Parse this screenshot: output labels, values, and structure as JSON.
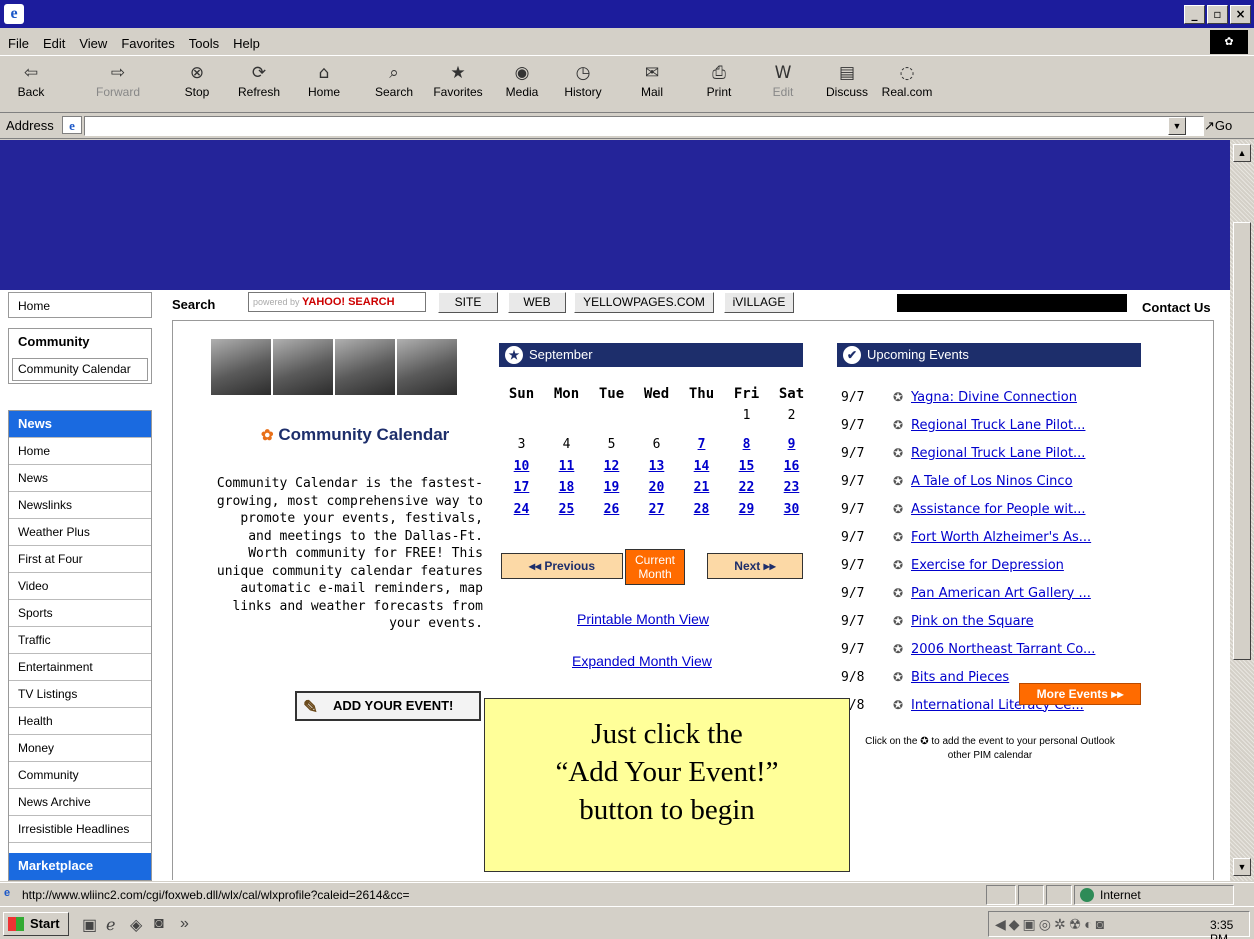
{
  "browser": {
    "menu": [
      "File",
      "Edit",
      "View",
      "Favorites",
      "Tools",
      "Help"
    ],
    "toolbar": [
      {
        "label": "Back",
        "icon": "back-arrow-icon"
      },
      {
        "label": "Forward",
        "icon": "forward-arrow-icon"
      },
      {
        "label": "Stop",
        "icon": "stop-icon"
      },
      {
        "label": "Refresh",
        "icon": "refresh-icon"
      },
      {
        "label": "Home",
        "icon": "home-icon"
      },
      {
        "label": "Search",
        "icon": "search-icon"
      },
      {
        "label": "Favorites",
        "icon": "favorites-icon"
      },
      {
        "label": "Media",
        "icon": "media-icon"
      },
      {
        "label": "History",
        "icon": "history-icon"
      },
      {
        "label": "Mail",
        "icon": "mail-icon"
      },
      {
        "label": "Print",
        "icon": "print-icon"
      },
      {
        "label": "Edit",
        "icon": "edit-icon"
      },
      {
        "label": "Discuss",
        "icon": "discuss-icon"
      },
      {
        "label": "Real.com",
        "icon": "realcom-icon"
      }
    ],
    "address_label": "Address",
    "address_value": "",
    "go_label": "Go",
    "status_url": "http://www.wliinc2.com/cgi/foxweb.dll/wlx/cal/wlxprofile?caleid=2614&cc=",
    "status_zone": "Internet"
  },
  "sidebar": {
    "home": "Home",
    "community_heading": "Community",
    "community_calendar": "Community Calendar",
    "news_heading": "News",
    "news_items": [
      "Home",
      "News",
      "Newslinks",
      "Weather Plus",
      "First at Four",
      "Video",
      "Sports",
      "Traffic",
      "Entertainment",
      "TV Listings",
      "Health",
      "Money",
      "Community",
      "News Archive",
      "Irresistible Headlines"
    ],
    "marketplace_heading": "Marketplace"
  },
  "search": {
    "label": "Search",
    "powered_by": "powered by",
    "engine": "YAHOO! SEARCH",
    "buttons": [
      "SITE",
      "WEB",
      "YELLOWPAGES.COM",
      "iVILLAGE"
    ],
    "contact": "Contact Us"
  },
  "intro": {
    "logo_text": "Community Calendar",
    "description": "Community Calendar is the fastest-growing, most comprehensive way to promote your events, festivals, and meetings to the Dallas-Ft. Worth community for FREE! This unique community calendar features automatic e-mail reminders, map links and weather forecasts from your events.",
    "add_event": "ADD YOUR EVENT!"
  },
  "calendar": {
    "month": "September",
    "days": [
      "Sun",
      "Mon",
      "Tue",
      "Wed",
      "Thu",
      "Fri",
      "Sat"
    ],
    "weeks": [
      [
        "",
        "",
        "",
        "",
        "",
        "1",
        "2"
      ],
      [
        "3",
        "4",
        "5",
        "6",
        "7",
        "8",
        "9"
      ],
      [
        "10",
        "11",
        "12",
        "13",
        "14",
        "15",
        "16"
      ],
      [
        "17",
        "18",
        "19",
        "20",
        "21",
        "22",
        "23"
      ],
      [
        "24",
        "25",
        "26",
        "27",
        "28",
        "29",
        "30"
      ]
    ],
    "first_linked_day": 7,
    "prev_label": "◂◂ Previous",
    "current_label": "Current Month",
    "next_label": "Next ▸▸",
    "printable": "Printable Month View",
    "expanded": "Expanded Month View"
  },
  "upcoming": {
    "heading": "Upcoming Events",
    "events": [
      {
        "date": "9/7",
        "title": "Yagna: Divine Connection"
      },
      {
        "date": "9/7",
        "title": "Regional Truck Lane Pilot..."
      },
      {
        "date": "9/7",
        "title": "Regional Truck Lane Pilot..."
      },
      {
        "date": "9/7",
        "title": "A Tale of Los Ninos Cinco"
      },
      {
        "date": "9/7",
        "title": "Assistance for People wit..."
      },
      {
        "date": "9/7",
        "title": "Fort Worth Alzheimer's As..."
      },
      {
        "date": "9/7",
        "title": "Exercise for Depression"
      },
      {
        "date": "9/7",
        "title": "Pan American Art Gallery ..."
      },
      {
        "date": "9/7",
        "title": "Pink on the Square"
      },
      {
        "date": "9/7",
        "title": "2006 Northeast Tarrant Co..."
      },
      {
        "date": "9/8",
        "title": "Bits and Pieces"
      },
      {
        "date": "9/8",
        "title": "International Literacy Ce..."
      }
    ],
    "more": "More Events ▸▸",
    "pim_note_before": "Click on the",
    "pim_note_after": "to add the event to your personal Outlook other PIM calendar"
  },
  "callout": {
    "line1": "Just click the",
    "line2": "“Add Your Event!”",
    "line3": "button to begin"
  },
  "taskbar": {
    "start": "Start",
    "quicklaunch_more": "»",
    "clock": "3:35 PM"
  },
  "colors": {
    "banner": "#242499",
    "panel_header": "#1d2e6b",
    "accent_orange": "#ff6b00",
    "nav_blue": "#1a6ae0",
    "callout": "#ffff99"
  }
}
